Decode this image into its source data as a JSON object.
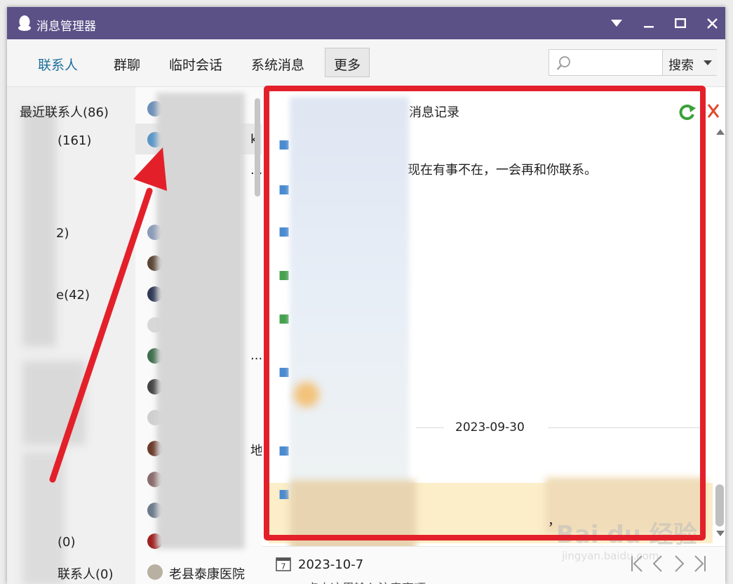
{
  "window": {
    "title": "消息管理器"
  },
  "tabs": [
    {
      "label": "联系人"
    },
    {
      "label": "群聊"
    },
    {
      "label": "临时会话"
    },
    {
      "label": "系统消息"
    },
    {
      "label": "更多"
    }
  ],
  "search": {
    "placeholder": "",
    "button_label": "搜索"
  },
  "groups": [
    {
      "label": "最近联系人(86)"
    },
    {
      "label": "(161)"
    },
    {
      "label": "2)"
    },
    {
      "label": "e(42)"
    },
    {
      "label": "(0)"
    },
    {
      "label": "联系人(0)"
    }
  ],
  "contacts": [
    {
      "label": "k"
    },
    {
      "label": "..."
    },
    {
      "label": "..."
    },
    {
      "label": "地"
    },
    {
      "label": "老县泰康医院"
    }
  ],
  "messages": {
    "header": "消息记录",
    "auto_reply": "现在有事不在，一会再和你联系。",
    "date_separator": "2023-09-30",
    "footer_date": "2023-10-7",
    "bottom_hint": "点击这里输入注意事项",
    "partial_text": "，"
  },
  "watermark": {
    "brand": "Bai du 经验",
    "url": "jingyan.baidu.com"
  },
  "colors": {
    "titlebar": "#5b5187",
    "accent_tab": "#1b6f9c",
    "annotation_red": "#e3202a",
    "highlight_row": "#fbeec8"
  },
  "annotation": {
    "highlight": "red-rectangle",
    "pointer": "red-arrow"
  }
}
